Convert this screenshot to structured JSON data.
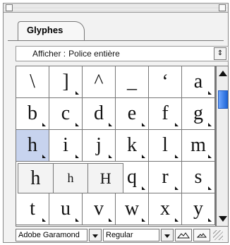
{
  "window": {
    "tab_label": "Glyphes"
  },
  "filter": {
    "label": "Afficher :",
    "value": "Police entière"
  },
  "glyphs": [
    [
      "\\",
      "]",
      "^",
      "_",
      "‘",
      "a"
    ],
    [
      "b",
      "c",
      "d",
      "e",
      "f",
      "g"
    ],
    [
      "h",
      "i",
      "j",
      "k",
      "l",
      "m"
    ],
    [
      "",
      "",
      "",
      "q",
      "r",
      "s"
    ],
    [
      "t",
      "u",
      "v",
      "w",
      "x",
      "y"
    ]
  ],
  "selected_glyph": "h",
  "alternates_popup": [
    "h",
    "h",
    "H"
  ],
  "bottom": {
    "font_family": "Adobe Garamond",
    "font_style": "Regular"
  },
  "icons": {
    "dropdown": "chevron-down-icon",
    "zoom_out": "mountain-large-icon",
    "zoom_in": "mountain-small-icon",
    "grip": "resize-grip-icon"
  }
}
